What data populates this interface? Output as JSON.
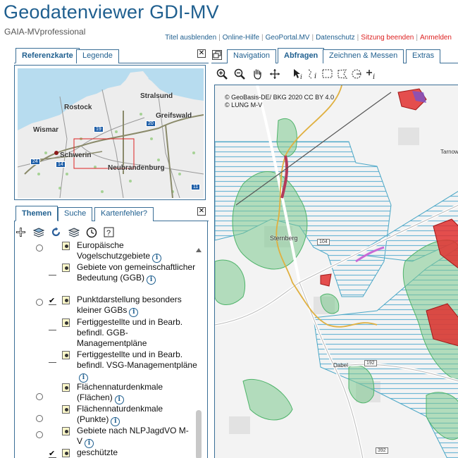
{
  "header": {
    "title": "Geodatenviewer GDI-MV",
    "subtitle": "GAIA-MVprofessional",
    "links": [
      {
        "label": "Titel ausblenden",
        "color": "blue"
      },
      {
        "label": "Online-Hilfe",
        "color": "blue"
      },
      {
        "label": "GeoPortal.MV",
        "color": "blue"
      },
      {
        "label": "Datenschutz",
        "color": "blue"
      },
      {
        "label": "Sitzung beenden",
        "color": "red"
      },
      {
        "label": "Anmelden",
        "color": "red"
      }
    ]
  },
  "ref_panel": {
    "tabs": {
      "referenzkarte": "Referenzkarte",
      "legende": "Legende"
    },
    "close": "✕",
    "cities": {
      "stralsund": "Stralsund",
      "rostock": "Rostock",
      "greifswald": "Greifswald",
      "wismar": "Wismar",
      "schwerin": "Schwerin",
      "neubrandenburg": "Neubrandenburg"
    },
    "shields": {
      "a19": "19",
      "a20": "20",
      "a24": "24",
      "a14": "14",
      "a11": "11"
    }
  },
  "themes_panel": {
    "tabs": {
      "themen": "Themen",
      "suche": "Suche",
      "kartenfehler": "Kartenfehler?"
    },
    "close": "✕",
    "info_glyph": "i",
    "check_glyph": "✔",
    "layers": [
      {
        "label": "Europäische Vogelschutzgebiete",
        "control": "radio"
      },
      {
        "label": "Gebiete von gemeinschaftlicher Bedeutung (GGB)",
        "control": "checkbox",
        "checked": false
      },
      {
        "label": "Punktdarstellung besonders kleiner GGBs",
        "control": "radio-checked",
        "checked": true
      },
      {
        "label": "Fertiggestellte und in Bearb. befindl. GGB-Managementpläne",
        "control": "checkbox",
        "checked": false
      },
      {
        "label": "Fertiggestellte und in Bearb. befindl. VSG-Managementpläne",
        "control": "checkbox",
        "checked": false
      },
      {
        "label": "Flächennaturdenkmale (Flächen)",
        "control": "radio"
      },
      {
        "label": "Flächennaturdenkmale (Punkte)",
        "control": "radio"
      },
      {
        "label": "Gebiete nach NLPJagdVO M-V",
        "control": "radio"
      },
      {
        "label": "geschützte",
        "control": "checkbox",
        "checked": true
      }
    ]
  },
  "map_panel": {
    "tabs": {
      "navigation": "Navigation",
      "abfragen": "Abfragen",
      "zeichnen": "Zeichnen & Messen",
      "extras": "Extras"
    },
    "copyright": [
      "© GeoBasis-DE/ BKG 2020 CC BY 4.0",
      "© LUNG M-V"
    ],
    "places": {
      "sternberg": "Sternberg",
      "dabel": "Dabel",
      "tarnow": "Tarnow"
    },
    "roads": {
      "r104": "104",
      "r192": "192",
      "r392": "392"
    }
  },
  "colors": {
    "accent": "#1f5f8f",
    "tab_border": "#3a6e96",
    "link_red": "#dd2222"
  }
}
